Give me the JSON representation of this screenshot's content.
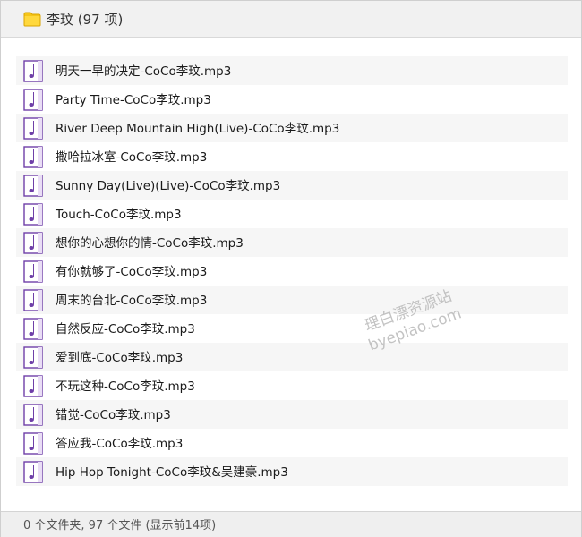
{
  "header": {
    "title": "李玟 (97 项)",
    "icon": "folder-icon"
  },
  "files": [
    {
      "name": "明天一早的决定-CoCo李玟.mp3",
      "icon": "music-file-icon"
    },
    {
      "name": "Party Time-CoCo李玟.mp3",
      "icon": "music-file-icon"
    },
    {
      "name": "River Deep Mountain High(Live)-CoCo李玟.mp3",
      "icon": "music-file-icon"
    },
    {
      "name": "撒哈拉冰室-CoCo李玟.mp3",
      "icon": "music-file-icon"
    },
    {
      "name": "Sunny Day(Live)(Live)-CoCo李玟.mp3",
      "icon": "music-file-icon"
    },
    {
      "name": "Touch-CoCo李玟.mp3",
      "icon": "music-file-icon"
    },
    {
      "name": "想你的心想你的情-CoCo李玟.mp3",
      "icon": "music-file-icon"
    },
    {
      "name": "有你就够了-CoCo李玟.mp3",
      "icon": "music-file-icon"
    },
    {
      "name": "周末的台北-CoCo李玟.mp3",
      "icon": "music-file-icon"
    },
    {
      "name": "自然反应-CoCo李玟.mp3",
      "icon": "music-file-icon"
    },
    {
      "name": "爱到底-CoCo李玟.mp3",
      "icon": "music-file-icon"
    },
    {
      "name": "不玩这种-CoCo李玟.mp3",
      "icon": "music-file-icon"
    },
    {
      "name": "错觉-CoCo李玟.mp3",
      "icon": "music-file-icon"
    },
    {
      "name": "答应我-CoCo李玟.mp3",
      "icon": "music-file-icon"
    },
    {
      "name": "Hip Hop Tonight-CoCo李玟&吴建豪.mp3",
      "icon": "music-file-icon"
    }
  ],
  "footer": {
    "status": "0 个文件夹, 97 个文件 (显示前14项)"
  },
  "watermark": {
    "line1": "理白漂资源站",
    "line2": "byepiao.com"
  },
  "colors": {
    "folder": "#f5c518",
    "file_border": "#6f3fa8",
    "row_alt": "#f6f6f6"
  }
}
